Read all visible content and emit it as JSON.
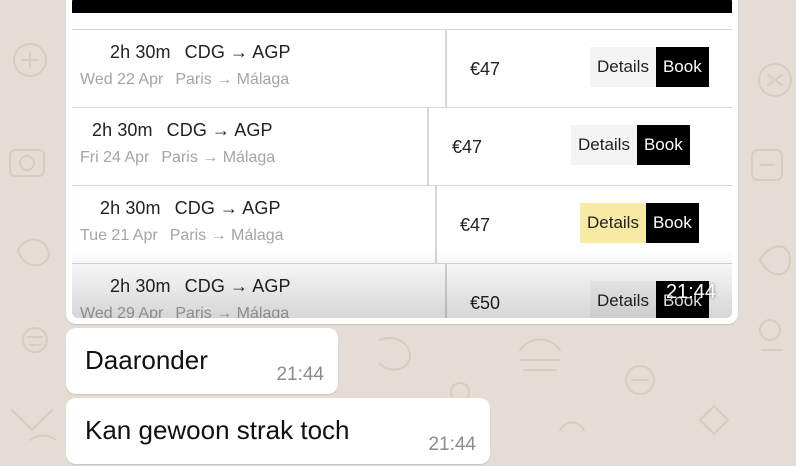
{
  "flights": [
    {
      "duration": "2h 30m",
      "route": "CDG → AGP",
      "date": "Wed 22 Apr",
      "cities": "Paris → Málaga",
      "price": "€47",
      "details_label": "Details",
      "book_label": "Book",
      "details_highlighted": false
    },
    {
      "duration": "2h 30m",
      "route": "CDG → AGP",
      "date": "Fri 24 Apr",
      "cities": "Paris → Málaga",
      "price": "€47",
      "details_label": "Details",
      "book_label": "Book",
      "details_highlighted": false
    },
    {
      "duration": "2h 30m",
      "route": "CDG → AGP",
      "date": "Tue 21 Apr",
      "cities": "Paris → Málaga",
      "price": "€47",
      "details_label": "Details",
      "book_label": "Book",
      "details_highlighted": true
    },
    {
      "duration": "2h 30m",
      "route": "CDG → AGP",
      "date": "Wed 29 Apr",
      "cities": "Paris → Málaga",
      "price": "€50",
      "details_label": "Details",
      "book_label": "Book",
      "details_highlighted": false
    }
  ],
  "image_message": {
    "time": "21:44"
  },
  "messages": [
    {
      "text": "Daaronder",
      "time": "21:44"
    },
    {
      "text": "Kan gewoon strak toch",
      "time": "21:44"
    }
  ],
  "colors": {
    "chat_background": "#e5ddd5",
    "bubble": "#ffffff",
    "details_highlight": "#f7eaa2",
    "book_button": "#000000"
  }
}
